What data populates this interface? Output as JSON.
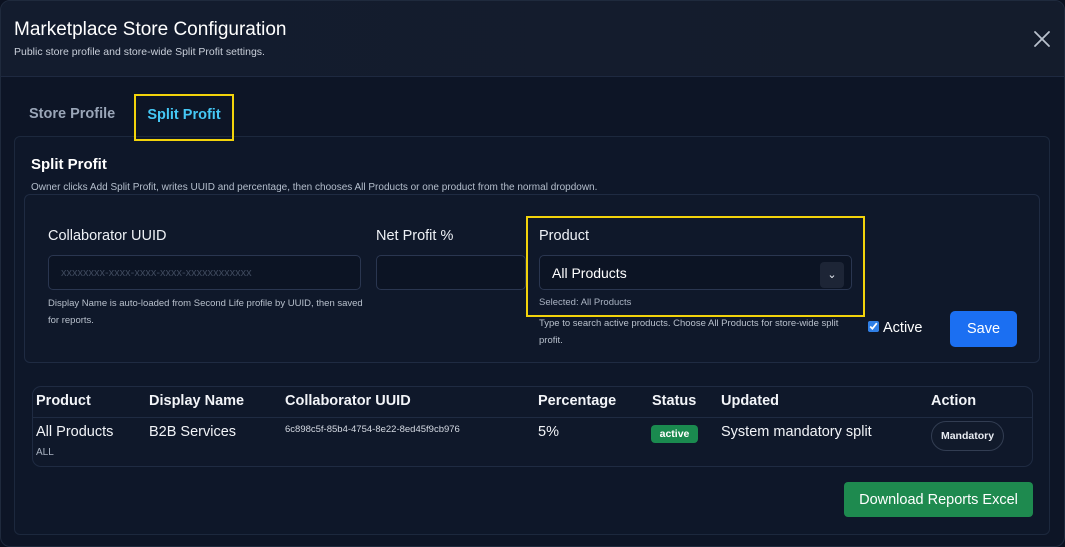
{
  "modal": {
    "title": "Marketplace Store Configuration",
    "subtitle": "Public store profile and store-wide Split Profit settings."
  },
  "tabs": [
    {
      "label": "Store Profile",
      "selected": false
    },
    {
      "label": "Split Profit",
      "selected": true
    }
  ],
  "split_profit": {
    "title": "Split Profit",
    "description": "Owner clicks Add Split Profit, writes UUID and percentage, then chooses All Products or one product from the normal dropdown.",
    "form": {
      "collaborator_uuid": {
        "label": "Collaborator UUID",
        "value": "",
        "placeholder": "xxxxxxxx-xxxx-xxxx-xxxx-xxxxxxxxxxxx",
        "help": "Display Name is auto-loaded from Second Life profile by UUID, then saved for reports."
      },
      "net_profit": {
        "label": "Net Profit %",
        "value": "",
        "placeholder": ""
      },
      "product": {
        "label": "Product",
        "selected_value": "All Products",
        "selected_note": "Selected: All Products",
        "help": "Type to search active products. Choose All Products for store-wide split profit."
      },
      "active": {
        "label": "Active",
        "checked": true
      },
      "save_label": "Save"
    },
    "table": {
      "headers": [
        "Product",
        "Display Name",
        "Collaborator UUID",
        "Percentage",
        "Status",
        "Updated",
        "Action"
      ],
      "rows": [
        {
          "product": "All Products",
          "product_code": "ALL",
          "display_name": "B2B Services",
          "uuid": "6c898c5f-85b4-4754-8e22-8ed45f9cb976",
          "percentage": "5%",
          "status": "active",
          "updated": "System mandatory split",
          "action": "Mandatory"
        }
      ]
    },
    "download_label": "Download Reports Excel"
  },
  "colors": {
    "accent_blue": "#1b6ff2",
    "tab_active": "#45c8f5",
    "highlight": "#f2d30b",
    "success": "#1e8a4f"
  },
  "icons": {
    "close": "close-icon",
    "dropdown": "chevron-down-icon"
  }
}
